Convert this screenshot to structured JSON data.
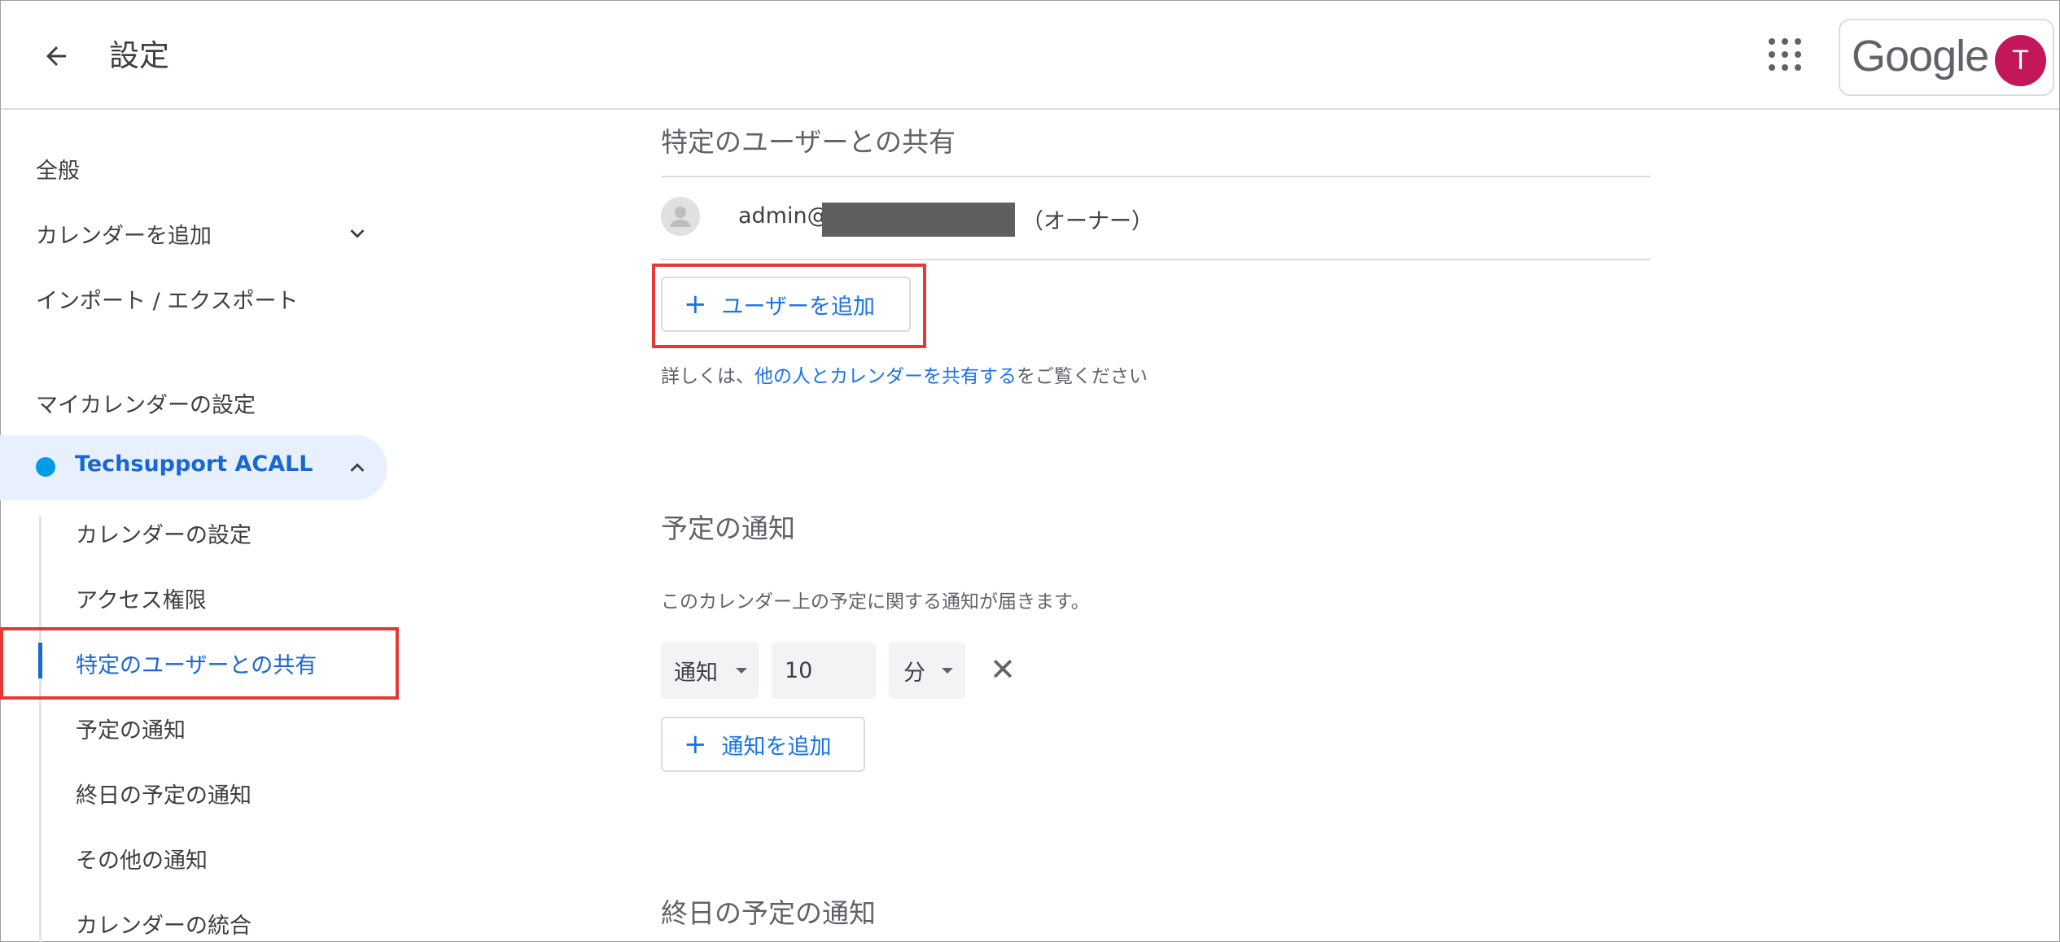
{
  "header": {
    "title": "設定",
    "google_logo": "Google",
    "avatar_initial": "T"
  },
  "sidebar": {
    "general": "全般",
    "add_calendar": "カレンダーを追加",
    "import_export": "インポート / エクスポート",
    "my_calendars_heading": "マイカレンダーの設定",
    "active_calendar": "Techsupport ACALL",
    "sub_items": [
      "カレンダーの設定",
      "アクセス権限",
      "特定のユーザーとの共有",
      "予定の通知",
      "終日の予定の通知",
      "その他の通知",
      "カレンダーの統合"
    ]
  },
  "main": {
    "sharing": {
      "title": "特定のユーザーとの共有",
      "user_email": "admin@",
      "user_role": "（オーナー）",
      "add_user_button": "ユーザーを追加",
      "help_prefix": "詳しくは、",
      "help_link": "他の人とカレンダーを共有する",
      "help_suffix": "をご覧ください"
    },
    "notifications": {
      "title": "予定の通知",
      "description": "このカレンダー上の予定に関する通知が届きます。",
      "type_value": "通知",
      "amount_value": "10",
      "unit_value": "分",
      "add_button": "通知を追加"
    },
    "all_day_title": "終日の予定の通知"
  },
  "colors": {
    "accent": "#1a73e8",
    "active_bg": "#e8f0fe",
    "calendar_dot": "#039be5",
    "avatar_bg": "#c2185b",
    "highlight_box": "#e53935"
  },
  "icons": [
    "back-arrow-icon",
    "apps-grid-icon",
    "chevron-down-icon",
    "chevron-up-icon",
    "person-icon",
    "plus-icon",
    "close-icon",
    "caret-down-icon"
  ]
}
